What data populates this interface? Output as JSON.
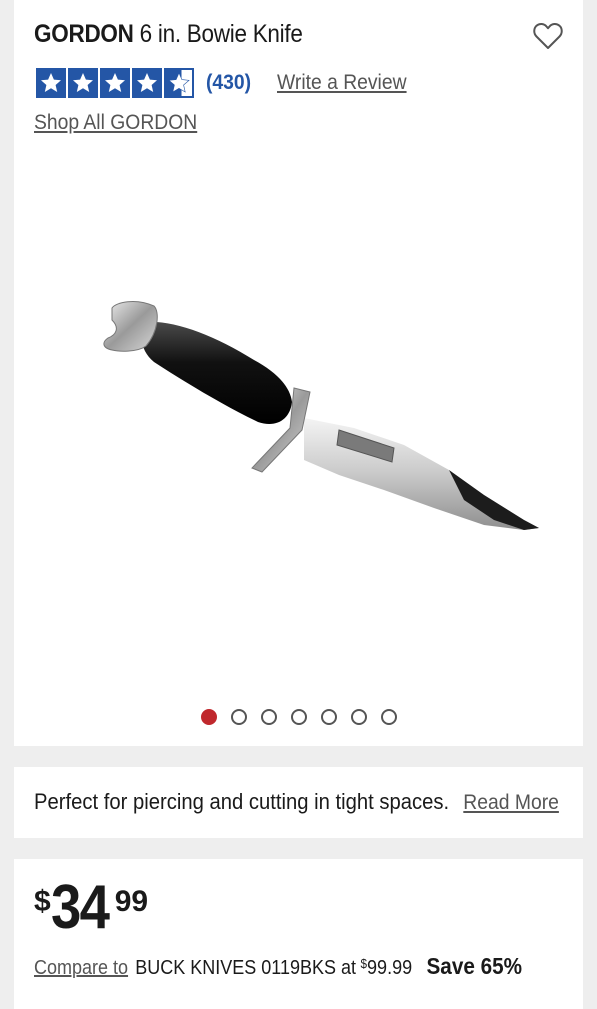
{
  "product": {
    "brand": "GORDON",
    "name": "6 in. Bowie Knife",
    "rating_stars": 4.5,
    "review_count": "(430)",
    "write_review_label": "Write a Review",
    "shop_all_label": "Shop All GORDON",
    "image_icon": "bowie-knife-image",
    "carousel": {
      "total": 7,
      "active_index": 0
    }
  },
  "description": {
    "text": "Perfect for piercing and cutting in tight spaces.",
    "read_more_label": "Read More"
  },
  "pricing": {
    "currency": "$",
    "dollars": "34",
    "cents": "99",
    "compare_label": "Compare to",
    "compare_item": "BUCK KNIVES 0119BKS at",
    "compare_currency": "$",
    "compare_price": "99.99",
    "save_label": "Save 65%"
  },
  "colors": {
    "star_blue": "#2456a6",
    "carousel_active": "#c0282d",
    "background": "#eeeeee"
  }
}
